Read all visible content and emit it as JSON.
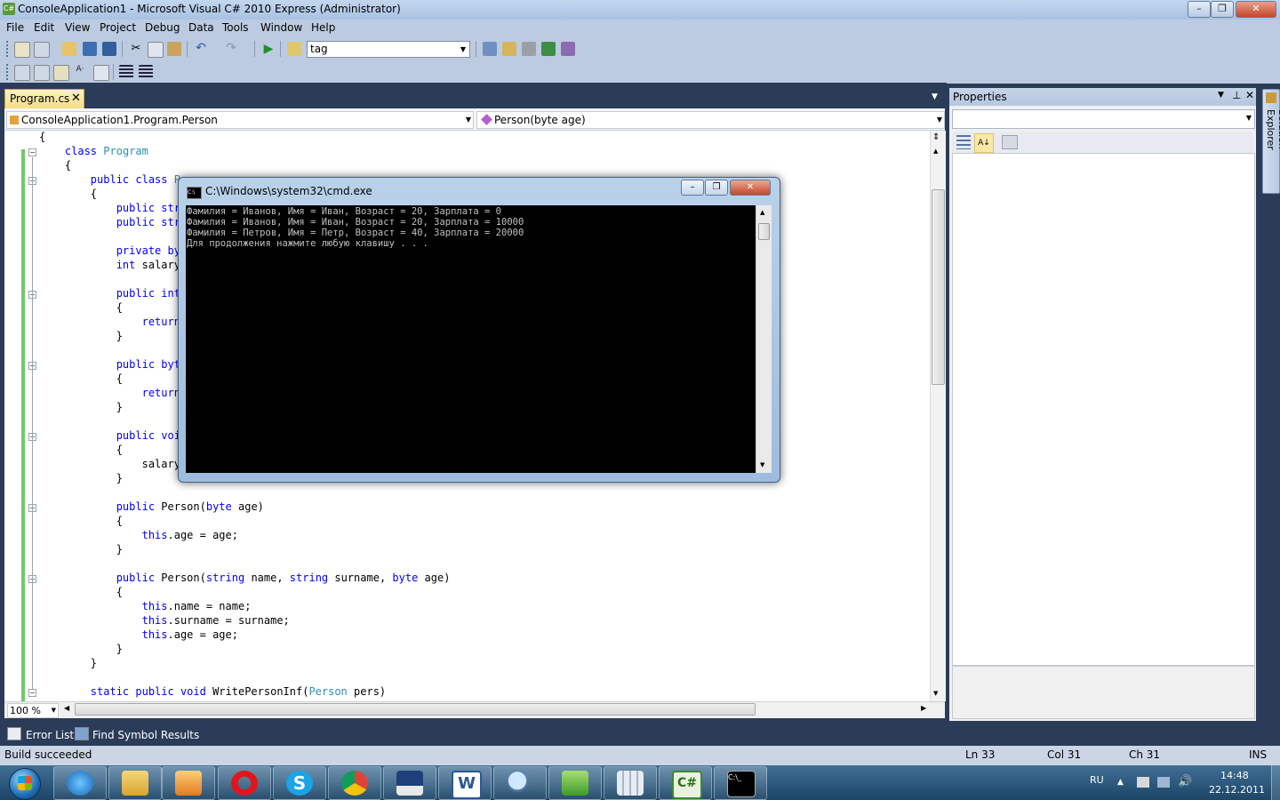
{
  "window": {
    "title": "ConsoleApplication1 - Microsoft Visual C# 2010 Express (Administrator)",
    "minimize": "–",
    "maximize": "❐",
    "close": "✕"
  },
  "menu": [
    "File",
    "Edit",
    "View",
    "Project",
    "Debug",
    "Data",
    "Tools",
    "Window",
    "Help"
  ],
  "toolbar": {
    "search_combo_value": "tag"
  },
  "editor": {
    "tab_label": "Program.cs",
    "tab_close": "✕",
    "nav_left": "ConsoleApplication1.Program.Person",
    "nav_right": "Person(byte age)",
    "zoom": "100 %"
  },
  "code_lines": [
    "{",
    "    class Program",
    "    {",
    "        public class P",
    "        {",
    "            public str",
    "            public str",
    "",
    "            private by",
    "            int salary",
    "",
    "            public int",
    "            {",
    "                return",
    "            }",
    "",
    "            public byt",
    "            {",
    "                return",
    "            }",
    "",
    "            public voi",
    "            {",
    "                salary",
    "            }",
    "",
    "            public Person(byte age)",
    "            {",
    "                this.age = age;",
    "            }",
    "",
    "            public Person(string name, string surname, byte age)",
    "            {",
    "                this.name = name;",
    "                this.surname = surname;",
    "                this.age = age;",
    "            }",
    "        }",
    "",
    "        static public void WritePersonInf(Person pers)"
  ],
  "properties": {
    "title": "Properties",
    "solution_explorer": "Solution Explorer"
  },
  "cmd": {
    "title": "C:\\Windows\\system32\\cmd.exe",
    "lines": [
      "Фамилия = Иванов, Имя = Иван, Возраст = 20, Зарплата = 0",
      "Фамилия = Иванов, Имя = Иван, Возраст = 20, Зарплата = 10000",
      "Фамилия = Петров, Имя = Петр, Возраст = 40, Зарплата = 20000",
      "Для продолжения нажмите любую клавишу . . ."
    ]
  },
  "bottom_tabs": [
    "Error List",
    "Find Symbol Results"
  ],
  "status": {
    "message": "Build succeeded",
    "ln": "Ln 33",
    "col": "Col 31",
    "ch": "Ch 31",
    "ins": "INS"
  },
  "taskbar": {
    "apps": [
      "internet-explorer-icon",
      "explorer-icon",
      "media-player-icon",
      "opera-icon",
      "skype-icon",
      "chrome-icon",
      "floppy-icon",
      "word-icon",
      "magnifier-icon",
      "recycle-icon",
      "calculator-icon",
      "csharp-icon",
      "cmd-icon"
    ],
    "lang": "RU",
    "time": "14:48",
    "date": "22.12.2011"
  },
  "colors": {
    "keyword": "#0000ff",
    "type": "#2b91af",
    "changed_margin": "#6fc96c",
    "active_tab": "#f6dd86"
  }
}
